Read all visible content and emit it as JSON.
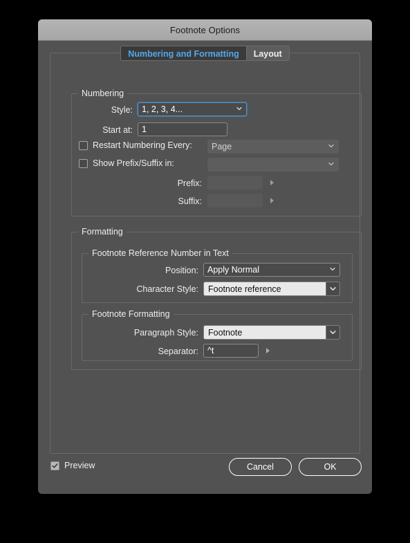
{
  "dialog": {
    "title": "Footnote Options"
  },
  "tabs": [
    {
      "label": "Numbering and Formatting",
      "active": true
    },
    {
      "label": "Layout",
      "active": false
    }
  ],
  "numbering": {
    "group_title": "Numbering",
    "style": {
      "label": "Style:",
      "value": "1, 2, 3, 4...",
      "focused": true
    },
    "start_at": {
      "label": "Start at:",
      "value": "1"
    },
    "restart_numbering": {
      "label": "Restart Numbering Every:",
      "checked": false,
      "value": "Page",
      "enabled": false
    },
    "show_prefix_suffix": {
      "label": "Show Prefix/Suffix in:",
      "checked": false,
      "value": "",
      "enabled": false
    },
    "prefix": {
      "label": "Prefix:",
      "value": "",
      "enabled": false
    },
    "suffix": {
      "label": "Suffix:",
      "value": "",
      "enabled": false
    }
  },
  "formatting": {
    "group_title": "Formatting",
    "reference_number": {
      "group_title": "Footnote Reference Number in Text",
      "position": {
        "label": "Position:",
        "value": "Apply Normal"
      },
      "character_style": {
        "label": "Character Style:",
        "value": "Footnote reference"
      }
    },
    "footnote_formatting": {
      "group_title": "Footnote Formatting",
      "paragraph_style": {
        "label": "Paragraph Style:",
        "value": "Footnote"
      },
      "separator": {
        "label": "Separator:",
        "value": "^t"
      }
    }
  },
  "footer": {
    "preview": {
      "label": "Preview",
      "checked": true
    },
    "cancel_label": "Cancel",
    "ok_label": "OK"
  },
  "colors": {
    "dialog_bg": "#525252",
    "titlebar": "#adadad",
    "accent_blue": "#52a8ec",
    "focus_blue": "#4a93d6",
    "combo_light": "#e9e9e9"
  }
}
